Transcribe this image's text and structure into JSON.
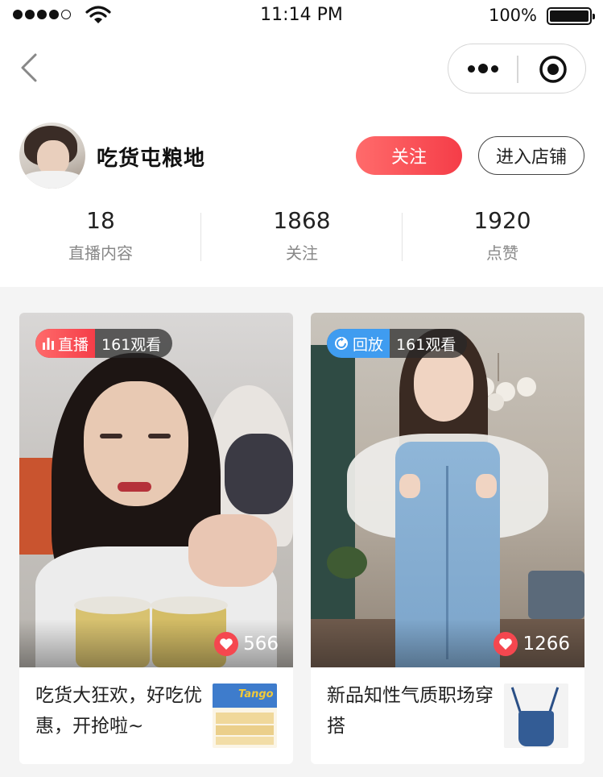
{
  "status_bar": {
    "time": "11:14 PM",
    "battery": "100%"
  },
  "nav": {
    "back_icon": "chevron-left-icon",
    "more_icon": "more-dots-icon",
    "close_icon": "target-circle-icon"
  },
  "profile": {
    "name": "吃货屯粮地",
    "follow_label": "关注",
    "shop_label": "进入店铺",
    "stats": [
      {
        "value": "18",
        "label": "直播内容"
      },
      {
        "value": "1868",
        "label": "关注"
      },
      {
        "value": "1920",
        "label": "点赞"
      }
    ]
  },
  "cards": [
    {
      "status": "直播",
      "status_icon": "live-bars-icon",
      "views": "161观看",
      "likes": "566",
      "title": "吃货大狂欢，好吃优惠，开抢啦~",
      "thumb_text": "Tango"
    },
    {
      "status": "回放",
      "status_icon": "replay-icon",
      "views": "161观看",
      "likes": "1266",
      "title": "新品知性气质职场穿搭"
    }
  ],
  "colors": {
    "accent_red": "#f53d48",
    "replay_blue": "#3f9cf0",
    "page_bg": "#f4f4f4"
  }
}
